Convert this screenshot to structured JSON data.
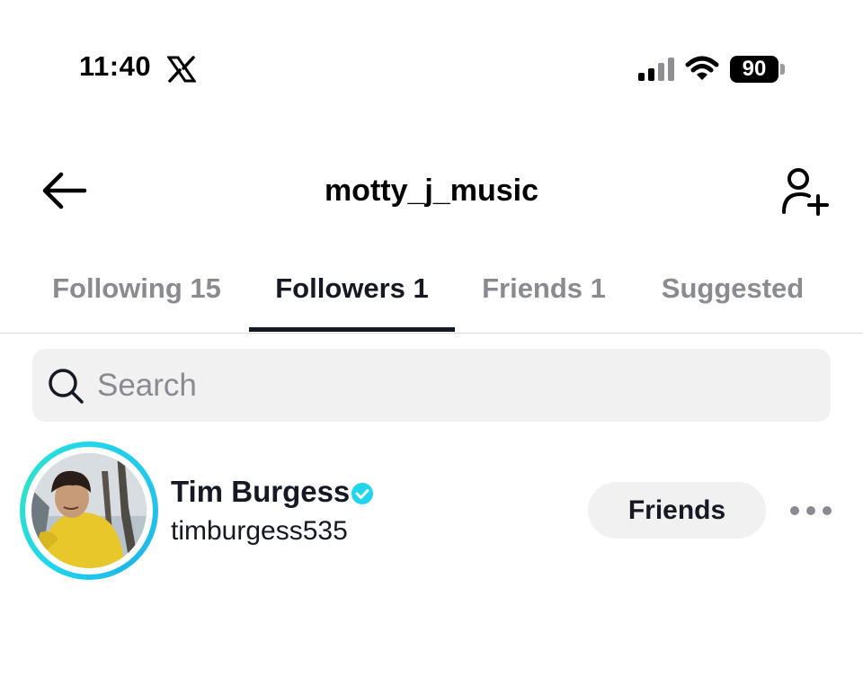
{
  "status_bar": {
    "time": "11:40",
    "battery_level": "90",
    "icons": [
      "x-logo-icon",
      "cellular-signal-icon",
      "wifi-icon",
      "battery-icon"
    ]
  },
  "header": {
    "title": "motty_j_music",
    "back_icon": "arrow-left-icon",
    "add_user_icon": "person-add-icon"
  },
  "tabs": [
    {
      "label": "Following 15",
      "active": false
    },
    {
      "label": "Followers 1",
      "active": true
    },
    {
      "label": "Friends 1",
      "active": false
    },
    {
      "label": "Suggested",
      "active": false
    }
  ],
  "search": {
    "placeholder": "Search",
    "value": ""
  },
  "followers": [
    {
      "display_name": "Tim Burgess",
      "username": "timburgess535",
      "verified": true,
      "button_label": "Friends"
    }
  ],
  "colors": {
    "text_primary": "#161823",
    "text_secondary": "#8a8b91",
    "surface": "#f1f1f2",
    "verified": "#20d5ec",
    "story_ring": "#20d5ec"
  }
}
